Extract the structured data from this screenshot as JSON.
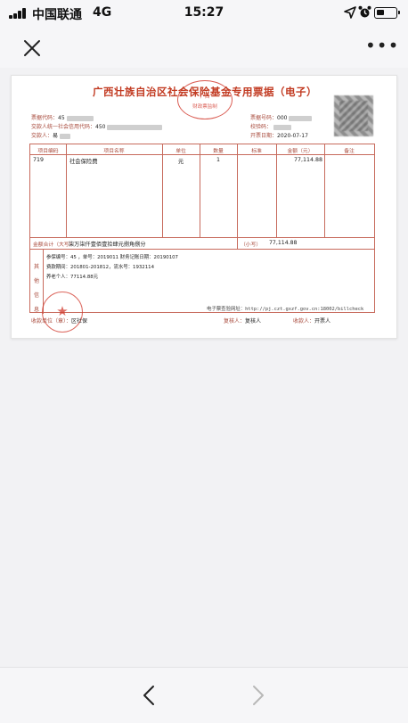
{
  "status": {
    "carrier": "中国联通",
    "network": "4G",
    "time": "15:27"
  },
  "nav": {
    "close_icon": "close-icon",
    "more_label": "•••"
  },
  "receipt": {
    "title": "广西壮族自治区社会保险基金专用票据（电子）",
    "seal_top_line1": "广西",
    "seal_top_line2": "财政票监制",
    "left_meta": [
      {
        "label": "票据代码：",
        "value": "45"
      },
      {
        "label": "交款人统一社会信用代码：",
        "value": "450"
      },
      {
        "label": "交款人：",
        "value": "易"
      }
    ],
    "right_meta": [
      {
        "label": "票据号码：",
        "value": "000"
      },
      {
        "label": "校验码：",
        "value": ""
      },
      {
        "label": "开票日期：",
        "value": "2020-07-17"
      }
    ],
    "columns": [
      "项目编码",
      "项目名称",
      "单位",
      "数量",
      "标准",
      "金额（元）",
      "备注"
    ],
    "row": {
      "code": "719",
      "name": "社会保险费",
      "unit": "元",
      "qty": "1",
      "standard": "",
      "amount": "77,114.88",
      "note": ""
    },
    "total_label": "金额合计（大写）",
    "total_text": "柒万柒仟壹佰壹拾肆元捌角捌分",
    "total_small_label": "（小写）",
    "total_small": "77,114.88",
    "other_label": "其他信息",
    "other_lines": [
      "参保编号：45          ，单号：2019011                财务记账日期：20190107",
      "费款期间：201801-201812，流水号：1932114",
      "养老个人：77114.88元"
    ],
    "verify": "电子票查验网址：http://pj.czt.gxzf.gov.cn:18002/billcheck",
    "footer": [
      {
        "label": "收款单位（章）：",
        "value": "区社保"
      },
      {
        "label": "复核人：",
        "value": "复核人"
      },
      {
        "label": "收款人：",
        "value": "开票人"
      }
    ]
  },
  "bottom": {
    "back_icon": "chevron-left-icon",
    "forward_icon": "chevron-right-icon"
  }
}
